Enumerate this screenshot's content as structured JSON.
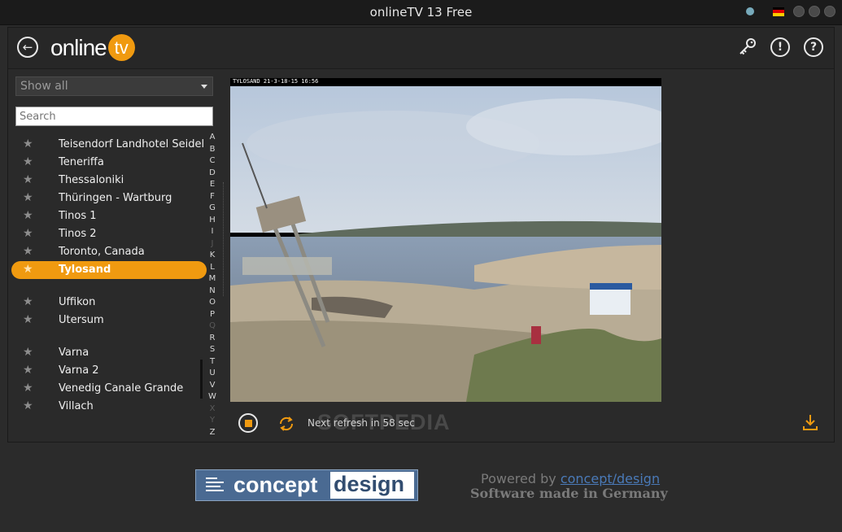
{
  "window": {
    "title": "onlineTV 13 Free"
  },
  "header": {
    "logo_text": "online",
    "logo_badge": "tv"
  },
  "filter": {
    "selected": "Show all"
  },
  "search": {
    "placeholder": "Search"
  },
  "channels": [
    {
      "name": "Teisendorf Landhotel Seidel",
      "selected": false
    },
    {
      "name": "Teneriffa",
      "selected": false
    },
    {
      "name": "Thessaloniki",
      "selected": false
    },
    {
      "name": "Thüringen - Wartburg",
      "selected": false
    },
    {
      "name": "Tinos 1",
      "selected": false
    },
    {
      "name": "Tinos 2",
      "selected": false
    },
    {
      "name": "Toronto, Canada",
      "selected": false
    },
    {
      "name": "Tylosand",
      "selected": true
    },
    {
      "name": "Uffikon",
      "selected": false
    },
    {
      "name": "Utersum",
      "selected": false
    },
    {
      "name": "Varna",
      "selected": false
    },
    {
      "name": "Varna 2",
      "selected": false
    },
    {
      "name": "Venedig Canale Grande",
      "selected": false
    },
    {
      "name": "Villach",
      "selected": false
    }
  ],
  "alphabet": [
    "A",
    "B",
    "C",
    "D",
    "E",
    "F",
    "G",
    "H",
    "I",
    "J",
    "K",
    "L",
    "M",
    "N",
    "O",
    "P",
    "Q",
    "R",
    "S",
    "T",
    "U",
    "V",
    "W",
    "X",
    "Y",
    "Z"
  ],
  "alphabet_disabled": [
    "J",
    "Q",
    "X",
    "Y"
  ],
  "player": {
    "osd_text": "TYLOSAND 21-3-18-15 16:56",
    "refresh_text": "Next refresh in 58 sec",
    "watermark": "SOFTPEDIA"
  },
  "footer": {
    "logo_word1": "concept",
    "logo_word2": "design",
    "powered_prefix": "Powered by ",
    "powered_link": "concept/design",
    "tagline": "Software made in Germany"
  },
  "colors": {
    "accent": "#f09a10",
    "background": "#2b2b2b",
    "link": "#4a7ab8"
  }
}
